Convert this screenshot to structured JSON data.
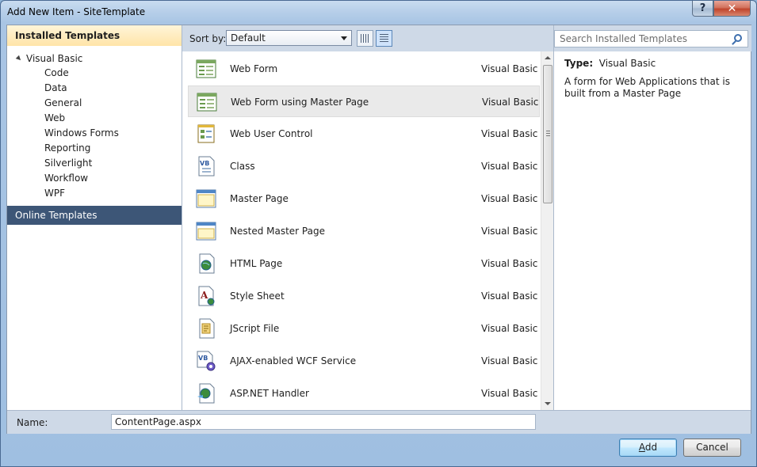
{
  "window": {
    "title": "Add New Item - SiteTemplate",
    "help_label": "?",
    "close_label": "✕"
  },
  "left": {
    "installed_header": "Installed Templates",
    "root": "Visual Basic",
    "items": [
      "Code",
      "Data",
      "General",
      "Web",
      "Windows Forms",
      "Reporting",
      "Silverlight",
      "Workflow",
      "WPF"
    ],
    "online": "Online Templates"
  },
  "sort": {
    "label": "Sort by:",
    "value": "Default"
  },
  "templates": [
    {
      "name": "Web Form",
      "lang": "Visual Basic",
      "icon": "web-form-icon"
    },
    {
      "name": "Web Form using Master Page",
      "lang": "Visual Basic",
      "icon": "web-form-master-icon"
    },
    {
      "name": "Web User Control",
      "lang": "Visual Basic",
      "icon": "user-control-icon"
    },
    {
      "name": "Class",
      "lang": "Visual Basic",
      "icon": "vb-class-icon"
    },
    {
      "name": "Master Page",
      "lang": "Visual Basic",
      "icon": "master-page-icon"
    },
    {
      "name": "Nested Master Page",
      "lang": "Visual Basic",
      "icon": "nested-master-page-icon"
    },
    {
      "name": "HTML Page",
      "lang": "Visual Basic",
      "icon": "html-page-icon"
    },
    {
      "name": "Style Sheet",
      "lang": "Visual Basic",
      "icon": "style-sheet-icon"
    },
    {
      "name": "JScript File",
      "lang": "Visual Basic",
      "icon": "jscript-file-icon"
    },
    {
      "name": "AJAX-enabled WCF Service",
      "lang": "Visual Basic",
      "icon": "wcf-service-icon"
    },
    {
      "name": "ASP.NET Handler",
      "lang": "Visual Basic",
      "icon": "aspnet-handler-icon"
    }
  ],
  "search": {
    "placeholder": "Search Installed Templates"
  },
  "details": {
    "type_label": "Type:",
    "type_value": "Visual Basic",
    "description": "A form for Web Applications that is built from a Master Page"
  },
  "name_field": {
    "label": "Name:",
    "value": "ContentPage.aspx"
  },
  "buttons": {
    "add_underlined": "A",
    "add_rest": "dd",
    "cancel": "Cancel"
  }
}
